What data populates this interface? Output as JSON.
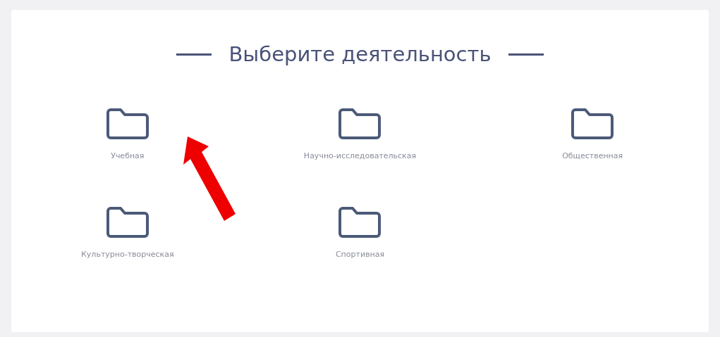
{
  "title": "Выберите деятельность",
  "activities": [
    {
      "label": "Учебная"
    },
    {
      "label": "Научно-исследовательская"
    },
    {
      "label": "Общественная"
    },
    {
      "label": "Культурно-творческая"
    },
    {
      "label": "Спортивная"
    }
  ]
}
